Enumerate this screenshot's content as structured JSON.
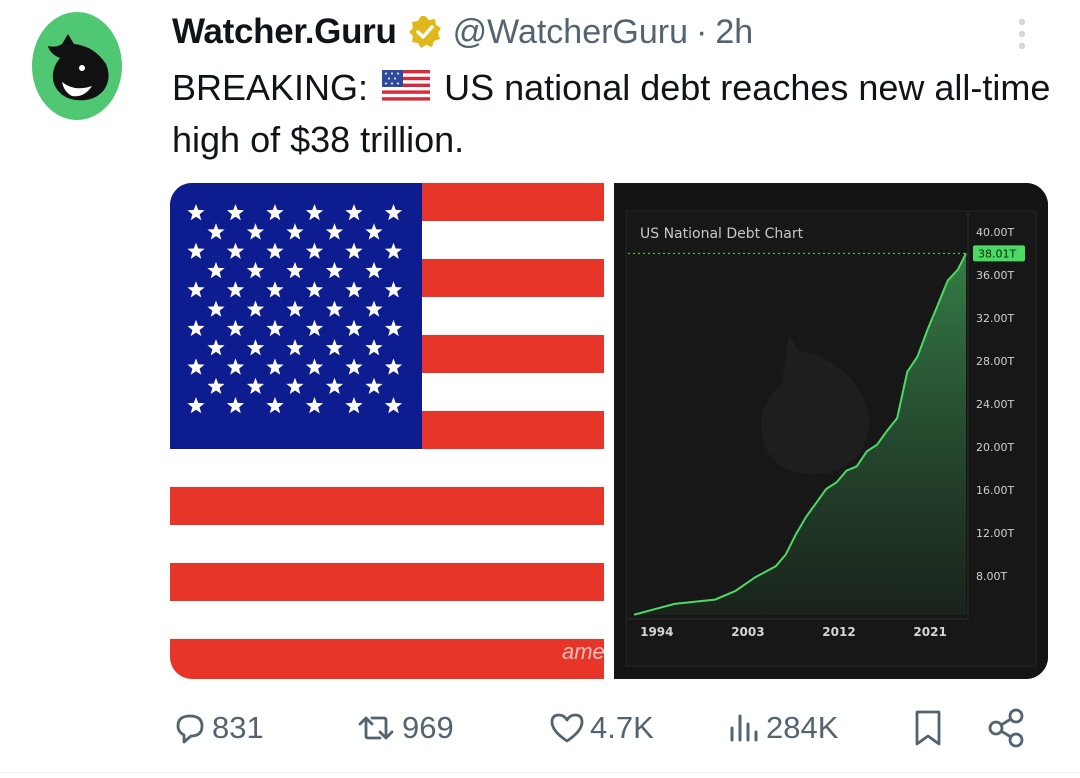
{
  "tweet": {
    "author_name": "Watcher.Guru",
    "handle": "@WatcherGuru",
    "separator": "·",
    "time": "2h",
    "text_prefix": "BREAKING:",
    "text_body": "US national debt reaches new all-time high of $38 trillion.",
    "brand_color": "#4fc773",
    "verified_color": "#e2b719"
  },
  "media": {
    "right_image": {
      "chart_title": "US National Debt Chart",
      "watermark_left": "ame",
      "current_value_label": "38.01T",
      "accent_color": "#4cd964",
      "chart_data": {
        "type": "area",
        "title": "US National Debt Chart",
        "x_ticks": [
          "1994",
          "2003",
          "2012",
          "2021"
        ],
        "y_ticks": [
          "40.00T",
          "36.00T",
          "32.00T",
          "28.00T",
          "24.00T",
          "20.00T",
          "16.00T",
          "12.00T",
          "8.00T"
        ],
        "current_label": "38.01T",
        "ylim": [
          5,
          40
        ],
        "xlim": [
          1993,
          2025.8
        ],
        "points": [
          [
            1993,
            4.4
          ],
          [
            1995,
            4.9
          ],
          [
            1997,
            5.4
          ],
          [
            1999,
            5.6
          ],
          [
            2001,
            5.8
          ],
          [
            2003,
            6.6
          ],
          [
            2005,
            7.9
          ],
          [
            2007,
            8.9
          ],
          [
            2008,
            10.0
          ],
          [
            2009,
            11.9
          ],
          [
            2010,
            13.5
          ],
          [
            2011,
            14.8
          ],
          [
            2012,
            16.1
          ],
          [
            2013,
            16.7
          ],
          [
            2014,
            17.8
          ],
          [
            2015,
            18.2
          ],
          [
            2016,
            19.6
          ],
          [
            2017,
            20.2
          ],
          [
            2018,
            21.5
          ],
          [
            2019,
            22.7
          ],
          [
            2020,
            27.0
          ],
          [
            2021,
            28.4
          ],
          [
            2022,
            30.9
          ],
          [
            2023,
            33.2
          ],
          [
            2024,
            35.5
          ],
          [
            2025,
            36.5
          ],
          [
            2025.8,
            38.01
          ]
        ]
      }
    }
  },
  "actions": {
    "replies": "831",
    "reposts": "969",
    "likes": "4.7K",
    "views": "284K",
    "icon_color": "#536471"
  }
}
